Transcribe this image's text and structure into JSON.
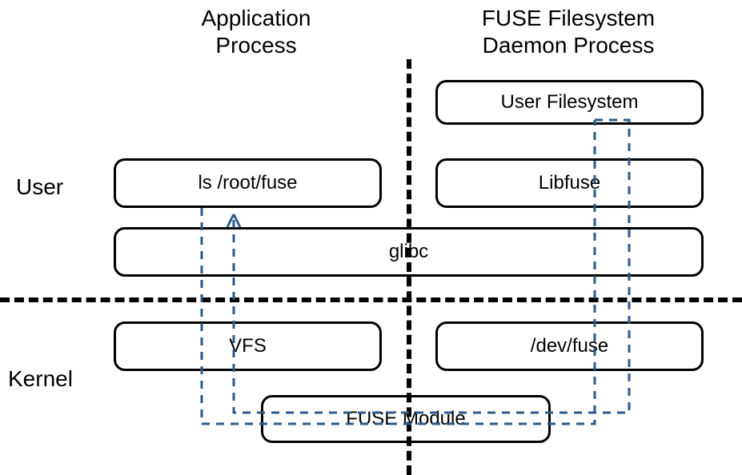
{
  "headers": {
    "left_line1": "Application",
    "left_line2": "Process",
    "right_line1": "FUSE Filesystem",
    "right_line2": "Daemon Process"
  },
  "side": {
    "user": "User",
    "kernel": "Kernel"
  },
  "boxes": {
    "user_filesystem": "User Filesystem",
    "ls_root_fuse": "ls /root/fuse",
    "libfuse": "Libfuse",
    "glibc": "glibc",
    "vfs": "VFS",
    "dev_fuse": "/dev/fuse",
    "fuse_module": "FUSE Module"
  },
  "chart_data": {
    "type": "diagram",
    "title": "FUSE architecture",
    "columns": [
      "Application Process",
      "FUSE Filesystem Daemon Process"
    ],
    "rows": [
      "User",
      "Kernel"
    ],
    "nodes": [
      {
        "id": "ls_root_fuse",
        "label": "ls /root/fuse",
        "column": "Application Process",
        "row": "User"
      },
      {
        "id": "user_filesystem",
        "label": "User Filesystem",
        "column": "FUSE Filesystem Daemon Process",
        "row": "User"
      },
      {
        "id": "libfuse",
        "label": "Libfuse",
        "column": "FUSE Filesystem Daemon Process",
        "row": "User"
      },
      {
        "id": "glibc",
        "label": "glibc",
        "column": "both",
        "row": "User"
      },
      {
        "id": "vfs",
        "label": "VFS",
        "column": "Application Process",
        "row": "Kernel"
      },
      {
        "id": "dev_fuse",
        "label": "/dev/fuse",
        "column": "FUSE Filesystem Daemon Process",
        "row": "Kernel"
      },
      {
        "id": "fuse_module",
        "label": "FUSE Module",
        "column": "both",
        "row": "Kernel"
      }
    ],
    "flow_path": [
      "ls_root_fuse",
      "vfs",
      "fuse_module",
      "dev_fuse",
      "libfuse",
      "user_filesystem",
      "libfuse",
      "dev_fuse",
      "fuse_module",
      "vfs",
      "ls_root_fuse"
    ],
    "flow_style": "bidirectional dashed blue path, returning with arrowhead to ls /root/fuse"
  }
}
